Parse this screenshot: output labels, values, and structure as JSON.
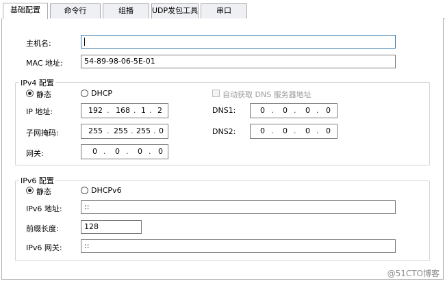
{
  "tabs": [
    {
      "label": "基础配置",
      "active": true
    },
    {
      "label": "命令行",
      "active": false
    },
    {
      "label": "组播",
      "active": false
    },
    {
      "label": "UDP发包工具",
      "active": false
    },
    {
      "label": "串口",
      "active": false
    }
  ],
  "basic": {
    "hostname_label": "主机名:",
    "hostname_value": "",
    "mac_label": "MAC 地址:",
    "mac_value": "54-89-98-06-5E-01"
  },
  "ipv4": {
    "title": "IPv4 配置",
    "static_label": "静态",
    "static_checked": true,
    "dhcp_label": "DHCP",
    "dhcp_checked": false,
    "auto_dns_label": "自动获取 DNS 服务器地址",
    "ip_label": "IP 地址:",
    "ip": [
      "192",
      "168",
      "1",
      "2"
    ],
    "mask_label": "子网掩码:",
    "mask": [
      "255",
      "255",
      "255",
      "0"
    ],
    "gateway_label": "网关:",
    "gateway": [
      "0",
      "0",
      "0",
      "0"
    ],
    "dns1_label": "DNS1:",
    "dns1": [
      "0",
      "0",
      "0",
      "0"
    ],
    "dns2_label": "DNS2:",
    "dns2": [
      "0",
      "0",
      "0",
      "0"
    ]
  },
  "ipv6": {
    "title": "IPv6 配置",
    "static_label": "静态",
    "static_checked": true,
    "dhcp_label": "DHCPv6",
    "dhcp_checked": false,
    "address_label": "IPv6 地址:",
    "address_value": "::",
    "prefix_label": "前缀长度:",
    "prefix_value": "128",
    "gateway_label": "IPv6 网关:",
    "gateway_value": "::"
  },
  "watermark": "@51CTO博客"
}
